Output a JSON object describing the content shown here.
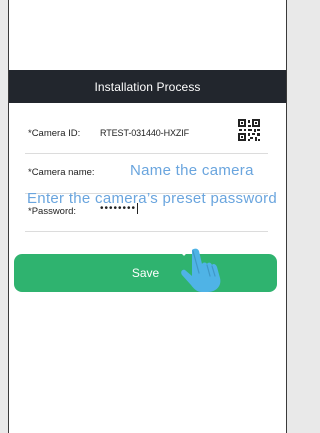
{
  "header": {
    "title": "Installation Process"
  },
  "form": {
    "camera_id_label": "*Camera ID:",
    "camera_id_value": "RTEST-031440-HXZIF",
    "camera_name_label": "*Camera name:",
    "camera_name_hint": "Name the camera",
    "password_hint": "Enter the camera’s preset password",
    "password_label": "*Password:",
    "password_value": "••••••••",
    "qr_icon": "qr-code-icon"
  },
  "actions": {
    "save_label": "Save"
  },
  "overlay": {
    "hand_icon": "tap-hand-icon"
  },
  "colors": {
    "header_bg": "#22262d",
    "accent_green": "#2fb36f",
    "hint_blue": "#6aa5de",
    "hand_blue": "#4fb3e6"
  }
}
